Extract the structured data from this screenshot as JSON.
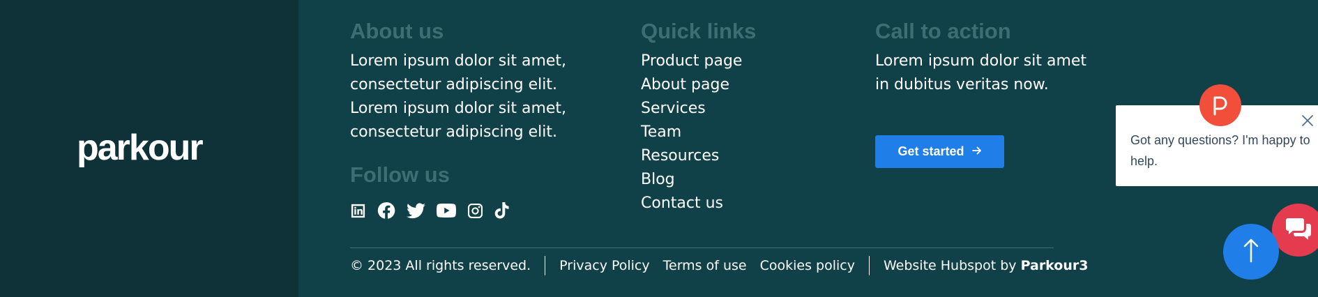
{
  "brand": {
    "logo_text": "parkour"
  },
  "about": {
    "heading": "About us",
    "lines": [
      "Lorem ipsum dolor sit amet,",
      "consectetur adipiscing elit.",
      "Lorem ipsum dolor sit amet,",
      "consectetur adipiscing elit."
    ]
  },
  "follow": {
    "heading": "Follow us",
    "icons": [
      "linkedin-icon",
      "facebook-icon",
      "twitter-icon",
      "youtube-icon",
      "instagram-icon",
      "tiktok-icon"
    ]
  },
  "quick_links": {
    "heading": "Quick links",
    "items": [
      "Product page",
      "About page",
      "Services",
      "Team",
      "Resources",
      "Blog",
      "Contact us"
    ]
  },
  "cta": {
    "heading": "Call to action",
    "lines": [
      "Lorem ipsum dolor sit amet",
      "in dubitus veritas now."
    ],
    "button_label": "Get started",
    "button_icon": "arrow-right-icon"
  },
  "bottom": {
    "copyright": "© 2023 All rights reserved.",
    "links": [
      "Privacy Policy",
      "Terms of use",
      "Cookies policy"
    ],
    "credit_prefix": "Website Hubspot by",
    "credit_name": "Parkour3"
  },
  "chat": {
    "message": "Got any questions? I'm happy to help.",
    "avatar_icon": "hubspot-p-icon",
    "close_icon": "close-icon",
    "launcher_icon": "chat-bubbles-icon"
  },
  "scroll_top": {
    "icon": "arrow-up-icon"
  },
  "colors": {
    "background": "#114148",
    "brand_panel": "#0e3237",
    "heading": "#3d6e74",
    "accent_blue": "#1f7ee8",
    "chat_red": "#e53b4f",
    "avatar_orange": "#f24e3c"
  }
}
